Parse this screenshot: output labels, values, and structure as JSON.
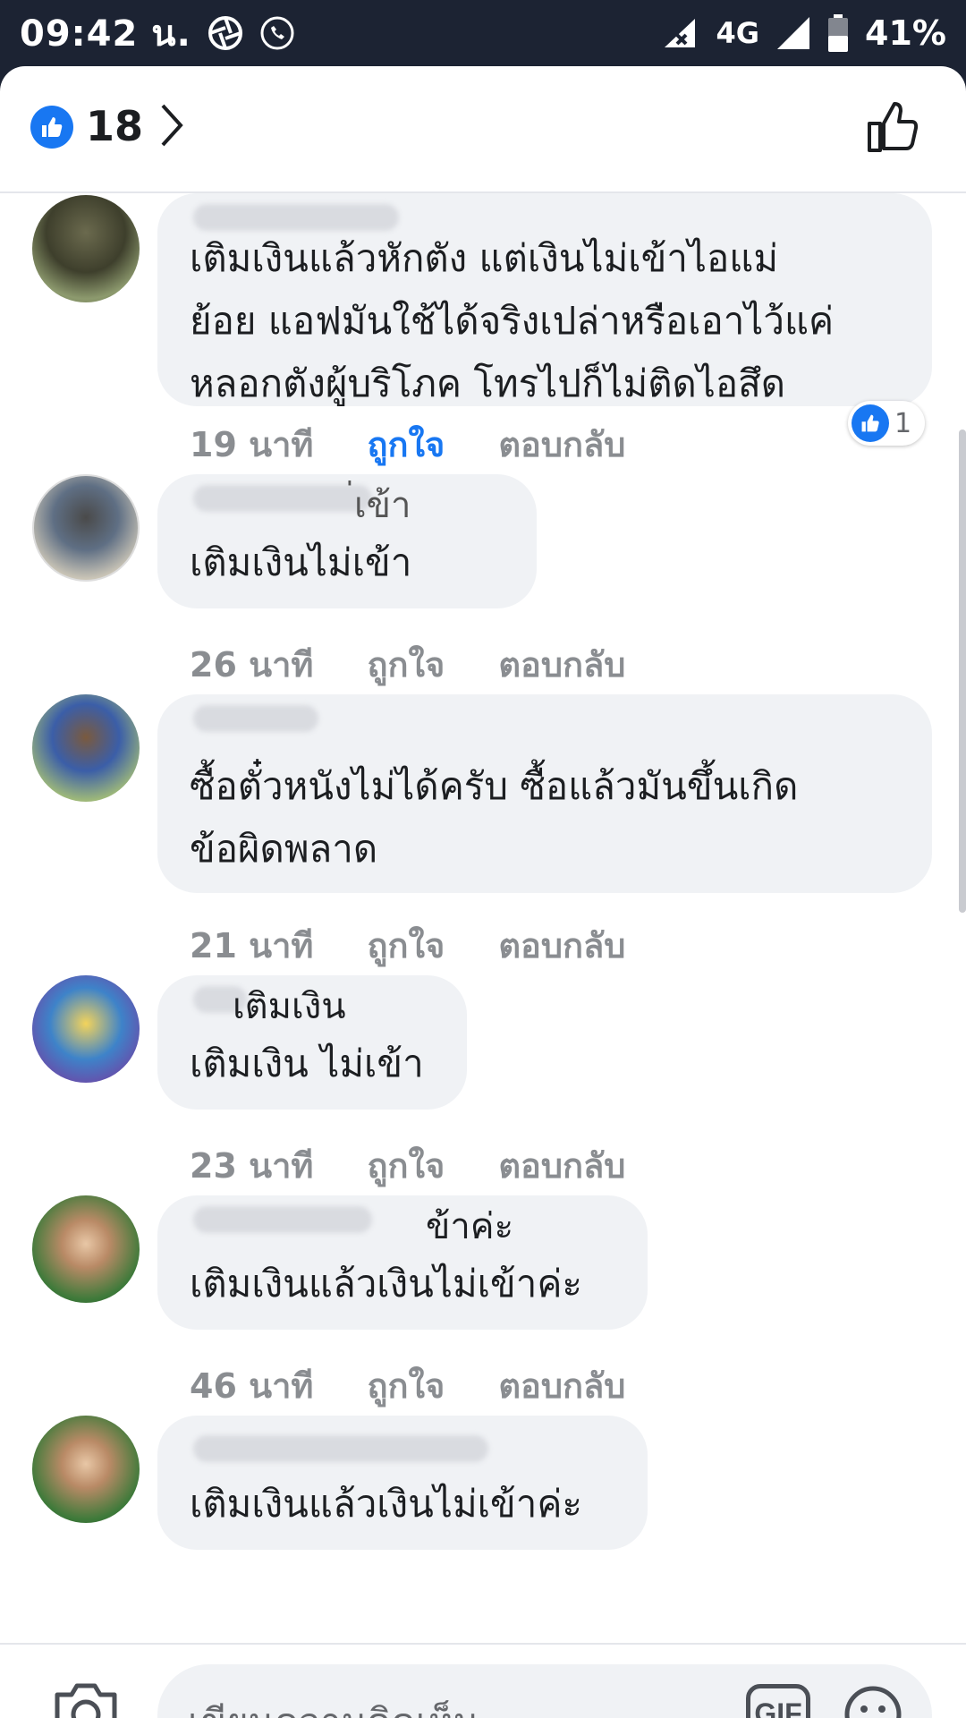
{
  "status_bar": {
    "time": "09:42 น.",
    "network": "4G",
    "battery": "41%"
  },
  "reactions": {
    "count": "18"
  },
  "comments": [
    {
      "text": "เติมเงินแล้วหักตัง แต่เงินไม่เข้าไอแม่\nย้อย แอฟมันใช้ได้จริงเปล่าหรือเอาไว้แค่\nหลอกตังผู้บริโภค โทรไปก็ไม่ติดไอสึด",
      "time": "19 นาที",
      "like_label": "ถูกใจ",
      "reply_label": "ตอบกลับ",
      "liked": true,
      "reaction_count": "1"
    },
    {
      "quoted": "่เข้า",
      "text": "เติมเงินไม่เข้า",
      "time": "26 นาที",
      "like_label": "ถูกใจ",
      "reply_label": "ตอบกลับ"
    },
    {
      "text": "ซื้อตั๋วหนังไม่ได้ครับ ซื้อแล้วมันขึ้นเกิด\nข้อผิดพลาด",
      "time": "21 นาที",
      "like_label": "ถูกใจ",
      "reply_label": "ตอบกลับ"
    },
    {
      "quoted": "เติมเงิน",
      "text": "เติมเงิน ไม่เข้า",
      "time": "23 นาที",
      "like_label": "ถูกใจ",
      "reply_label": "ตอบกลับ"
    },
    {
      "quoted": "ข้าค่ะ",
      "text": "เติมเงินแล้วเงินไม่เข้าค่ะ",
      "time": "46 นาที",
      "like_label": "ถูกใจ",
      "reply_label": "ตอบกลับ"
    },
    {
      "text": "เติมเงินแล้วเงินไม่เข้าค่ะ"
    }
  ],
  "composer": {
    "placeholder": "เขียนความคิดเห็น...",
    "gif_label": "GIF"
  },
  "colors": {
    "accent": "#1877f2",
    "bubble": "#f0f2f5",
    "meta": "#8a8d91",
    "status_bar": "#1c2333"
  }
}
